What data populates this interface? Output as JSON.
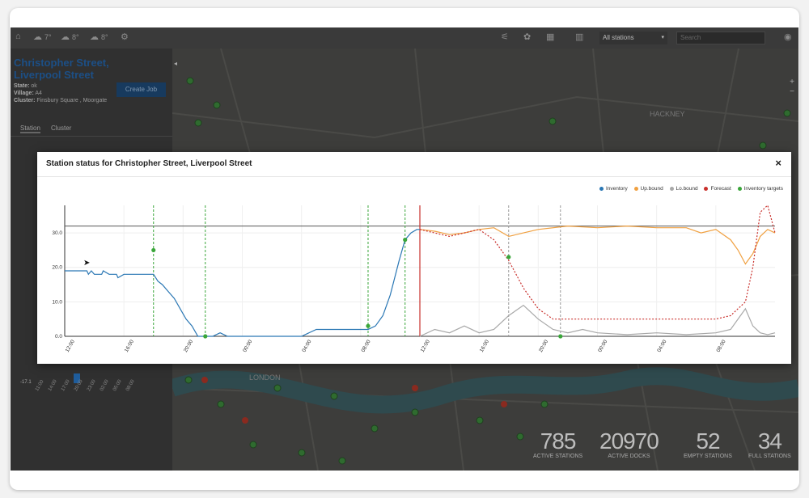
{
  "topbar": {
    "weather": [
      "7°",
      "8°",
      "8°"
    ],
    "station_select": "All stations",
    "search_placeholder": "Search"
  },
  "left_panel": {
    "station_title": "Christopher Street, Liverpool Street",
    "state_label": "State:",
    "state_value": "ok",
    "village_label": "Village:",
    "village_value": "A4",
    "cluster_label": "Cluster:",
    "cluster_value": "Finsbury Square , Moorgate",
    "create_job_label": "Create Job",
    "tabs": [
      "Station",
      "Cluster"
    ],
    "mini_chart": {
      "value_label": "-17.1",
      "ticks": [
        "11:00",
        "14:00",
        "17:00",
        "20:00",
        "23:00",
        "02:00",
        "05:00",
        "08:00"
      ]
    }
  },
  "map": {
    "labels": [
      "HACKNEY",
      "LONDON"
    ]
  },
  "stats": [
    {
      "value": "785",
      "label": "ACTIVE STATIONS"
    },
    {
      "value": "20970",
      "label": "ACTIVE DOCKS"
    },
    {
      "value": "52",
      "label": "EMPTY STATIONS"
    },
    {
      "value": "34",
      "label": "FULL STATIONS"
    }
  ],
  "modal": {
    "title": "Station status for Christopher Street, Liverpool Street",
    "close_label": "×"
  },
  "colors": {
    "inventory": "#2a77b4",
    "upbound": "#f0a040",
    "lobound": "#a8a8a8",
    "forecast": "#c9302c",
    "target": "#3aa63a"
  },
  "chart_data": {
    "type": "line",
    "legend": [
      "Inventory",
      "Up.bound",
      "Lo.bound",
      "Forecast",
      "Inventory targets"
    ],
    "legend_position": "top-right",
    "x_ticks": [
      "12:00",
      "16:00",
      "20:00",
      "00:00",
      "04:00",
      "08:00",
      "12:00",
      "16:00",
      "20:00",
      "00:00",
      "04:00",
      "08:00"
    ],
    "y_ticks": [
      "0.0",
      "10.0",
      "20.0",
      "30.0"
    ],
    "ylim": [
      0,
      38
    ],
    "xlim": [
      0,
      48
    ],
    "capacity_line": 32,
    "now_marker": 24,
    "target_lines": [
      6,
      9.5,
      20.5,
      23,
      30,
      33.5
    ],
    "series": [
      {
        "name": "Inventory",
        "x": [
          0,
          0.3,
          1,
          1.5,
          1.6,
          1.8,
          2,
          2.5,
          2.6,
          3,
          3.5,
          3.6,
          4,
          5,
          5.5,
          6,
          6.3,
          6.6,
          7,
          7.4,
          7.8,
          8.2,
          8.6,
          9,
          9.5,
          10,
          10.5,
          11,
          12,
          16,
          17,
          20,
          20.5,
          21,
          21.5,
          22,
          22.3,
          22.6,
          23,
          23.4,
          23.8,
          24
        ],
        "y": [
          19,
          19,
          19,
          19,
          18,
          19,
          18,
          18,
          19,
          18,
          18,
          17,
          18,
          18,
          18,
          18,
          16,
          15,
          13,
          11,
          8,
          5,
          3,
          0,
          0,
          0,
          1,
          0,
          0,
          0,
          2,
          2,
          2,
          3,
          6,
          12,
          17,
          22,
          28,
          30,
          31,
          31
        ]
      },
      {
        "name": "Up.bound",
        "x": [
          24,
          25,
          26,
          27,
          28,
          29,
          30,
          31,
          32,
          34,
          36,
          38,
          40,
          42,
          43,
          44,
          45,
          45.5,
          46,
          46.5,
          47,
          47.5,
          48
        ],
        "y": [
          31,
          30.5,
          29.5,
          30,
          31,
          31.5,
          29,
          30,
          31,
          32,
          31.5,
          32,
          31.5,
          31.5,
          30,
          31,
          28,
          25,
          21,
          24,
          29,
          31,
          30
        ]
      },
      {
        "name": "Lo.bound",
        "x": [
          24,
          25,
          26,
          27,
          28,
          29,
          30,
          31,
          32,
          33,
          34,
          35,
          36,
          38,
          40,
          42,
          44,
          45,
          46,
          46.5,
          47,
          47.5,
          48
        ],
        "y": [
          0,
          2,
          1,
          3,
          1,
          2,
          6,
          9,
          5,
          2,
          1,
          2,
          1,
          0.5,
          1,
          0.5,
          1,
          2,
          8,
          3,
          1,
          0.5,
          1
        ],
        "line_style": "solid"
      },
      {
        "name": "Forecast",
        "x": [
          24,
          26,
          28,
          29,
          30,
          31,
          32,
          33,
          34,
          36,
          38,
          40,
          42,
          44,
          45,
          46,
          46.5,
          47,
          47.5,
          48
        ],
        "y": [
          31,
          29,
          31,
          28,
          22,
          14,
          8,
          5,
          5,
          5,
          5,
          5,
          5,
          5,
          6,
          10,
          20,
          36,
          38,
          30
        ],
        "line_style": "dotted"
      }
    ],
    "targets": {
      "name": "Inventory targets",
      "x": [
        6,
        9.5,
        20.5,
        23,
        30,
        33.5
      ],
      "y": [
        25,
        0,
        3,
        28,
        23,
        0
      ]
    }
  }
}
